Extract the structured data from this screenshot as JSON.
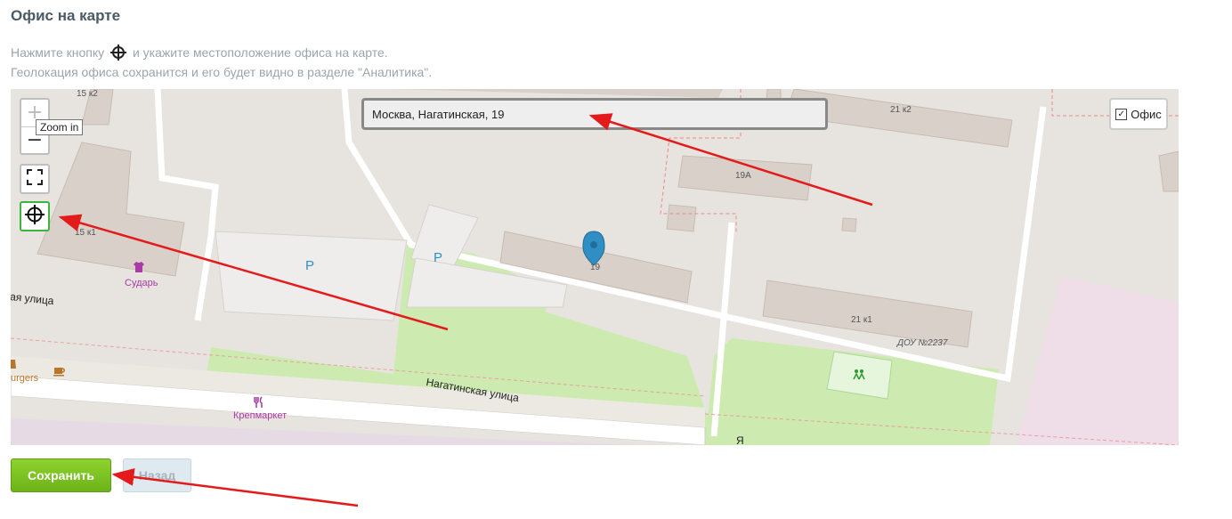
{
  "page": {
    "title": "Офис на карте",
    "hint_line1_before": "Нажмите кнопку",
    "hint_line1_after": "и укажите местоположение офиса на карте.",
    "hint_line2": "Геолокация офиса сохранится и его будет видно в разделе \"Аналитика\"."
  },
  "map": {
    "zoom_in": "+",
    "zoom_out": "−",
    "zoom_in_tooltip": "Zoom in",
    "search_value": "Москва, Нагатинская, 19",
    "office_toggle": "Офис",
    "office_checked": "✓",
    "labels": {
      "b15k2": "15 к2",
      "b15k1": "15 к1",
      "b21k2": "21 к2",
      "b19a": "19А",
      "b19": "19",
      "b21k1": "21 к1",
      "dou": "ДОУ №2237",
      "street_left": "ая улица",
      "street_main": "Нагатинская улица",
      "poi_sudar": "Сударь",
      "poi_krepmarket": "Крепмаркет",
      "poi_burgers": "urgers",
      "parking": "P",
      "street_bottom": "Я"
    }
  },
  "actions": {
    "save": "Сохранить",
    "back": "Назад"
  },
  "colors": {
    "accent": "#6cb31a",
    "marker": "#2f8fc4",
    "arrow": "#e31b1b"
  }
}
